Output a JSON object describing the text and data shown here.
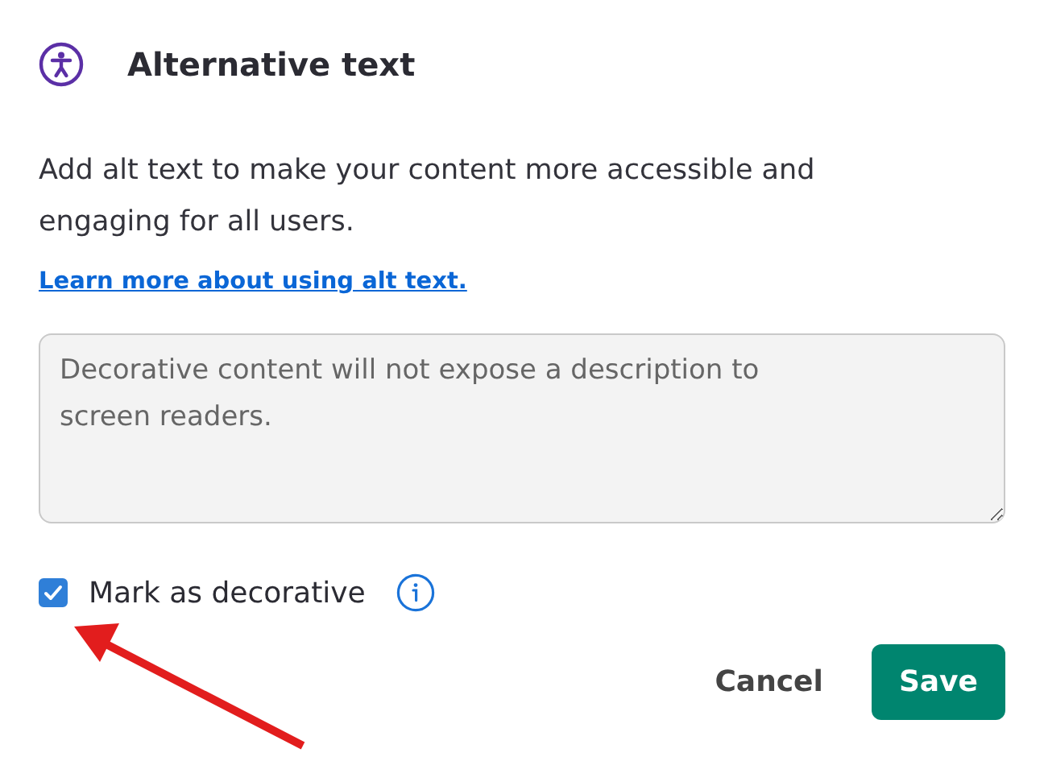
{
  "dialog": {
    "title": "Alternative text",
    "description": "Add alt text to make your content more accessible and engaging for all users.",
    "link": "Learn more about using alt text.",
    "alt_text_field": {
      "placeholder": "Decorative content will not expose a description to screen readers.",
      "disabled": true
    },
    "decorative_checkbox": {
      "label": "Mark as decorative",
      "checked": true
    },
    "buttons": [
      {
        "label": "Cancel",
        "kind": "secondary"
      },
      {
        "label": "Save",
        "kind": "primary"
      }
    ]
  },
  "annotation": {
    "kind": "arrow"
  }
}
